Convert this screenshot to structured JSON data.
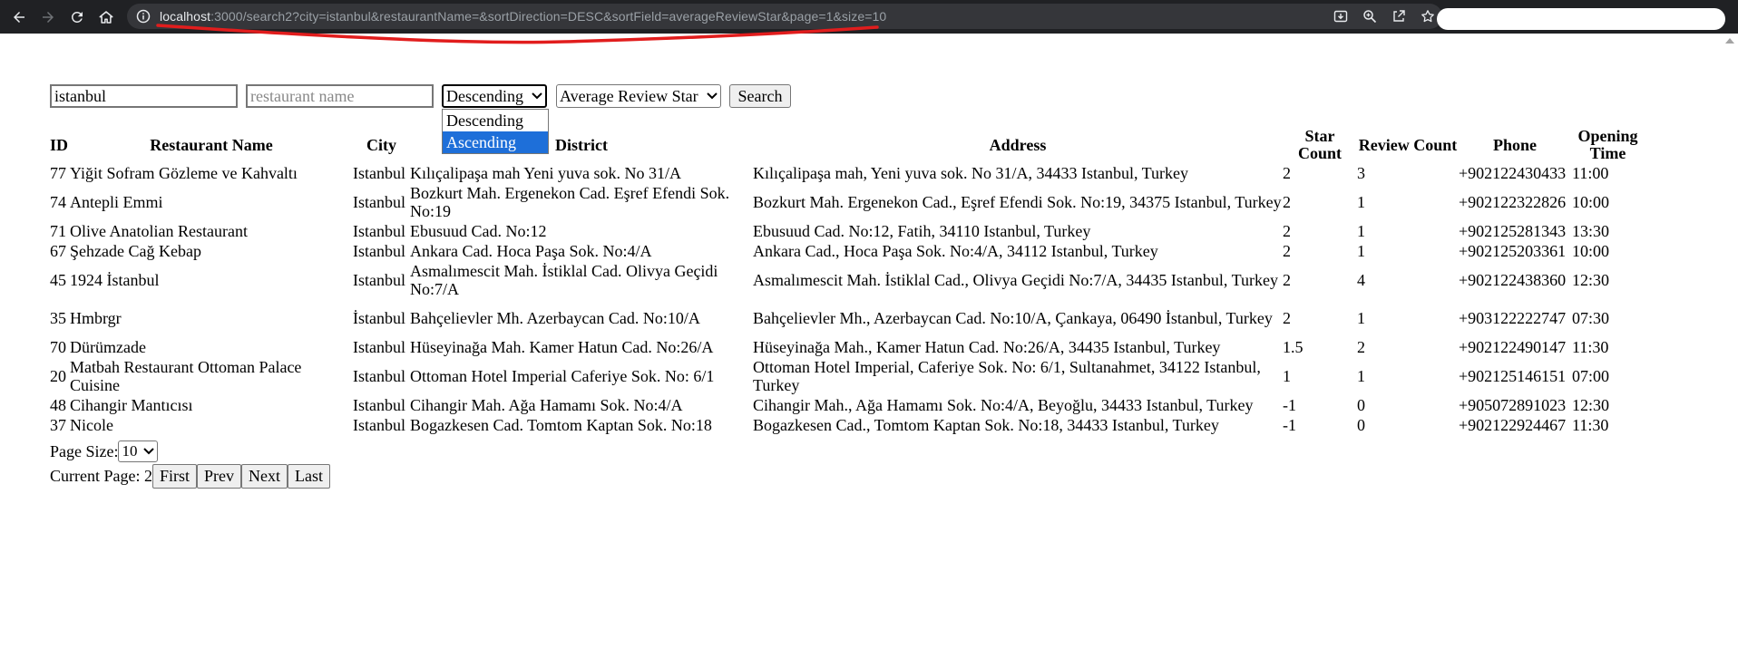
{
  "browser": {
    "url_host": "localhost",
    "url_rest": ":3000/search2?city=istanbul&restaurantName=&sortDirection=DESC&sortField=averageReviewStar&page=1&size=10"
  },
  "search": {
    "city_value": "istanbul",
    "name_placeholder": "restaurant name",
    "sort_direction_value": "Descending",
    "sort_field_value": "Average Review Star",
    "search_label": "Search",
    "direction_options": [
      {
        "label": "Descending",
        "highlighted": false
      },
      {
        "label": "Ascending",
        "highlighted": true
      }
    ]
  },
  "table": {
    "headers": {
      "id": "ID",
      "name": "Restaurant Name",
      "city": "City",
      "district": "District",
      "address": "Address",
      "star_count": "Star Count",
      "review_count": "Review Count",
      "phone": "Phone",
      "opening_time": "Opening Time"
    },
    "rows": [
      {
        "id": "77",
        "name": "Yiğit Sofram Gözleme ve Kahvaltı",
        "city": "Istanbul",
        "district": "Kılıçalipaşa mah Yeni yuva sok. No 31/A",
        "address": "Kılıçalipaşa mah, Yeni yuva sok. No 31/A, 34433 Istanbul, Turkey",
        "star_count": "2",
        "review_count": "3",
        "phone": "+902122430433",
        "opening_time": "11:00"
      },
      {
        "id": "74",
        "name": "Antepli Emmi",
        "city": "Istanbul",
        "district": "Bozkurt Mah. Ergenekon Cad. Eşref Efendi Sok. No:19",
        "address": "Bozkurt Mah. Ergenekon Cad., Eşref Efendi Sok. No:19, 34375 Istanbul, Turkey",
        "star_count": "2",
        "review_count": "1",
        "phone": "+902122322826",
        "opening_time": "10:00"
      },
      {
        "id": "71",
        "name": "Olive Anatolian Restaurant",
        "city": "Istanbul",
        "district": "Ebusuud Cad. No:12",
        "address": "Ebusuud Cad. No:12, Fatih, 34110 Istanbul, Turkey",
        "star_count": "2",
        "review_count": "1",
        "phone": "+902125281343",
        "opening_time": "13:30"
      },
      {
        "id": "67",
        "name": "Şehzade Cağ Kebap",
        "city": "Istanbul",
        "district": "Ankara Cad. Hoca Paşa Sok. No:4/A",
        "address": "Ankara Cad., Hoca Paşa Sok. No:4/A, 34112 Istanbul, Turkey",
        "star_count": "2",
        "review_count": "1",
        "phone": "+902125203361",
        "opening_time": "10:00"
      },
      {
        "id": "45",
        "name": "1924 İstanbul",
        "city": "Istanbul",
        "district": "Asmalımescit Mah. İstiklal Cad. Olivya Geçidi No:7/A",
        "address": "Asmalımescit Mah. İstiklal Cad., Olivya Geçidi No:7/A, 34435 Istanbul, Turkey",
        "star_count": "2",
        "review_count": "4",
        "phone": "+902122438360",
        "opening_time": "12:30"
      },
      {
        "id": "35",
        "name": "Hmbrgr",
        "city": "İstanbul",
        "district": "Bahçelievler Mh. Azerbaycan Cad. No:10/A",
        "address": "Bahçelievler Mh., Azerbaycan Cad. No:10/A, Çankaya, 06490 İstanbul, Turkey",
        "star_count": "2",
        "review_count": "1",
        "phone": "+903122222747",
        "opening_time": "07:30"
      },
      {
        "id": "70",
        "name": "Dürümzade",
        "city": "Istanbul",
        "district": "Hüseyinağa Mah. Kamer Hatun Cad. No:26/A",
        "address": "Hüseyinağa Mah., Kamer Hatun Cad. No:26/A, 34435 Istanbul, Turkey",
        "star_count": "1.5",
        "review_count": "2",
        "phone": "+902122490147",
        "opening_time": "11:30"
      },
      {
        "id": "20",
        "name": "Matbah Restaurant Ottoman Palace Cuisine",
        "city": "Istanbul",
        "district": "Ottoman Hotel Imperial Caferiye Sok. No: 6/1",
        "address": "Ottoman Hotel Imperial, Caferiye Sok. No: 6/1, Sultanahmet, 34122 Istanbul, Turkey",
        "star_count": "1",
        "review_count": "1",
        "phone": "+902125146151",
        "opening_time": "07:00"
      },
      {
        "id": "48",
        "name": "Cihangir Mantıcısı",
        "city": "Istanbul",
        "district": "Cihangir Mah. Ağa Hamamı Sok. No:4/A",
        "address": "Cihangir Mah., Ağa Hamamı Sok. No:4/A, Beyoğlu, 34433 Istanbul, Turkey",
        "star_count": "-1",
        "review_count": "0",
        "phone": "+905072891023",
        "opening_time": "12:30"
      },
      {
        "id": "37",
        "name": "Nicole",
        "city": "Istanbul",
        "district": "Bogazkesen Cad. Tomtom Kaptan Sok. No:18",
        "address": "Bogazkesen Cad., Tomtom Kaptan Sok. No:18, 34433 Istanbul, Turkey",
        "star_count": "-1",
        "review_count": "0",
        "phone": "+902122924467",
        "opening_time": "11:30"
      }
    ]
  },
  "pagination": {
    "page_size_label": "Page Size:",
    "page_size_value": "10",
    "current_page_label": "Current Page: 2",
    "first_label": "First",
    "prev_label": "Prev",
    "next_label": "Next",
    "last_label": "Last"
  },
  "colors": {
    "chrome_bg": "#202124",
    "omnibox_bg": "#35363a",
    "highlight": "#1e6fd9",
    "annotation_red": "#e11d1d"
  },
  "icons": [
    "back-arrow-icon",
    "forward-arrow-icon",
    "reload-icon",
    "home-icon",
    "site-info-icon",
    "install-app-icon",
    "zoom-icon",
    "share-icon",
    "bookmark-star-icon",
    "chevron-down-icon"
  ]
}
